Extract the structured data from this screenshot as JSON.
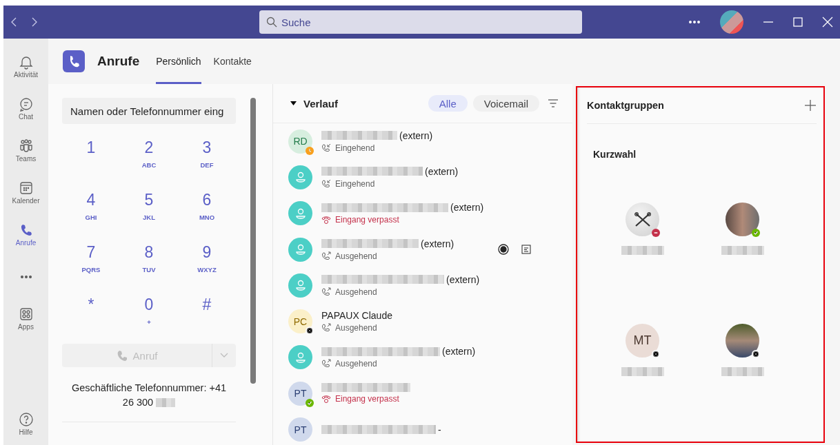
{
  "titlebar": {
    "search": {
      "placeholder": "Suche"
    }
  },
  "rail": [
    {
      "kind": "bell",
      "label": "Aktivität",
      "selected": false
    },
    {
      "kind": "chat",
      "label": "Chat",
      "selected": false
    },
    {
      "kind": "teams",
      "label": "Teams",
      "selected": false
    },
    {
      "kind": "calendar",
      "label": "Kalender",
      "selected": false
    },
    {
      "kind": "phone",
      "label": "Anrufe",
      "selected": true
    },
    {
      "kind": "more",
      "selected": false
    },
    {
      "kind": "apps",
      "label": "Apps",
      "selected": false
    }
  ],
  "help": {
    "label": "Hilfe"
  },
  "header": {
    "title": "Anrufe",
    "tabs": [
      {
        "label": "Persönlich",
        "selected": true
      },
      {
        "label": "Kontakte",
        "selected": false
      }
    ]
  },
  "dialpad": {
    "placeholder": "Namen oder Telefonnummer eing",
    "keys": [
      {
        "digit": "1"
      },
      {
        "digit": "2",
        "letters": "ABC"
      },
      {
        "digit": "3",
        "letters": "DEF"
      },
      {
        "digit": "4",
        "letters": "GHI"
      },
      {
        "digit": "5",
        "letters": "JKL"
      },
      {
        "digit": "6",
        "letters": "MNO"
      },
      {
        "digit": "7",
        "letters": "PQRS"
      },
      {
        "digit": "8",
        "letters": "TUV"
      },
      {
        "digit": "9",
        "letters": "WXYZ"
      },
      {
        "digit": "*"
      },
      {
        "digit": "0",
        "letters": "+"
      },
      {
        "digit": "#"
      }
    ],
    "call_button": {
      "label": "Anruf",
      "disabled": true
    },
    "business_number": [
      "Geschäftliche Telefonnummer: +41",
      "26 300"
    ]
  },
  "history": {
    "title": "Verlauf",
    "expanded": true,
    "filters": [
      {
        "label": "Alle",
        "selected": true
      },
      {
        "label": "Voicemail",
        "selected": false
      }
    ],
    "calls": [
      {
        "kind": "initials",
        "initials": "RD",
        "color": "#d7eedf",
        "name": "(extern)",
        "redacted": true,
        "status": {
          "kind": "incoming",
          "label": "Eingehend"
        },
        "presence": {
          "kind": "away"
        },
        "hovered": false
      },
      {
        "kind": "person",
        "color": "#4ccfc6",
        "name": "(extern)",
        "redacted": true,
        "status": {
          "kind": "incoming",
          "label": "Eingehend"
        },
        "hovered": false
      },
      {
        "kind": "person",
        "color": "#4ccfc6",
        "name": "(extern)",
        "redacted": true,
        "status": {
          "kind": "missed",
          "label": "Eingang verpasst"
        },
        "hovered": false
      },
      {
        "kind": "person",
        "color": "#4ccfc6",
        "name": "(extern)",
        "redacted": true,
        "status": {
          "kind": "outgoing",
          "label": "Ausgehend"
        },
        "hovered": true
      },
      {
        "kind": "person",
        "color": "#4ccfc6",
        "name": "(extern)",
        "redacted": true,
        "status": {
          "kind": "outgoing",
          "label": "Ausgehend"
        },
        "hovered": false
      },
      {
        "kind": "initials",
        "initials": "PC",
        "color": "#fbf0c9",
        "name": "PAPAUX Claude",
        "redacted": false,
        "status": {
          "kind": "outgoing",
          "label": "Ausgehend"
        },
        "presence": {
          "kind": "offline"
        },
        "hovered": false
      },
      {
        "kind": "person",
        "color": "#4ccfc6",
        "name": "(extern)",
        "redacted": true,
        "status": {
          "kind": "outgoing",
          "label": "Ausgehend"
        },
        "hovered": false
      },
      {
        "kind": "initials",
        "initials": "PT",
        "color": "#d0d9ec",
        "redacted": true,
        "status": {
          "kind": "missed",
          "label": "Eingang verpasst"
        },
        "presence": {
          "kind": "available"
        },
        "hovered": false
      },
      {
        "kind": "initials",
        "initials": "PT",
        "color": "#d0d9ec",
        "name": "-",
        "redacted": true,
        "hovered": false
      }
    ]
  },
  "contact_groups": {
    "title": "Kontaktgruppen",
    "group": "Kurzwahl",
    "contacts": [
      {
        "kind": "logo",
        "presence": {
          "kind": "dnd"
        }
      },
      {
        "kind": "photo",
        "presence": {
          "kind": "available"
        }
      },
      {
        "kind": "initials",
        "initials": "MT",
        "presence": {
          "kind": "offline"
        }
      },
      {
        "kind": "photo",
        "presence": {
          "kind": "offline"
        }
      }
    ]
  }
}
